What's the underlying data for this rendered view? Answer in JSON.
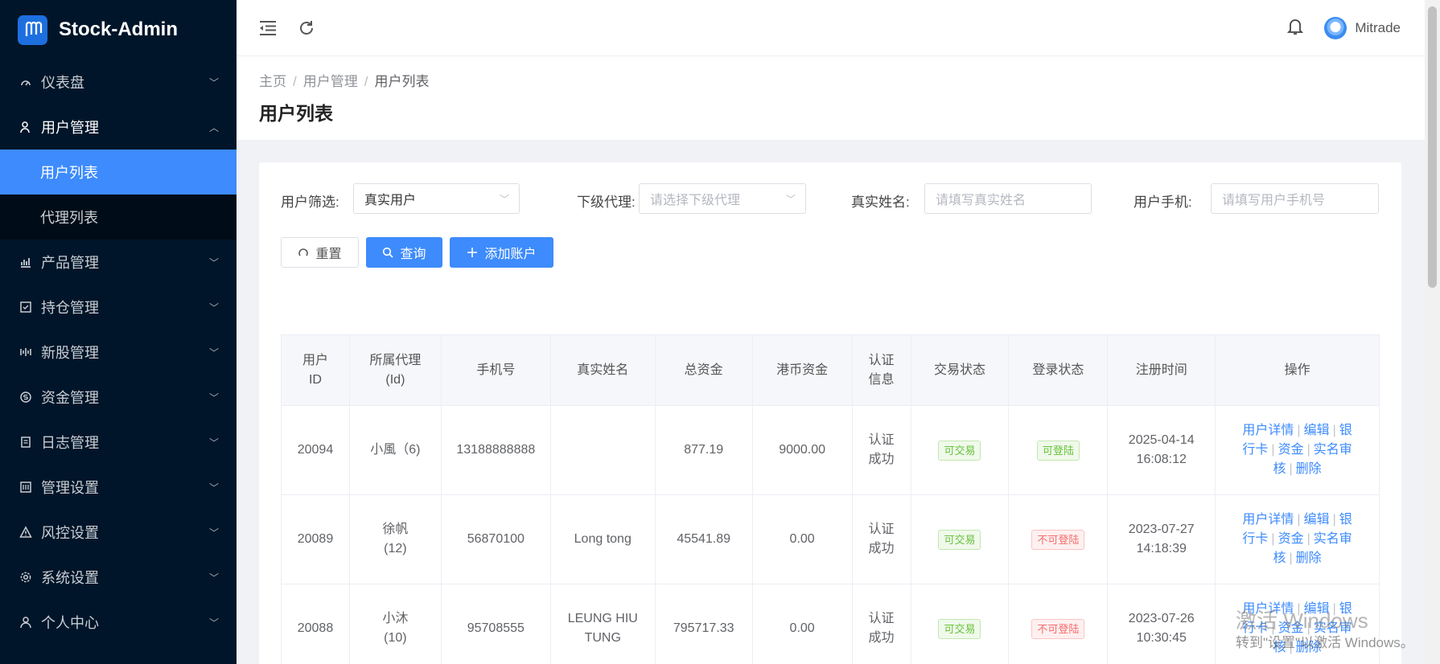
{
  "app": {
    "title": "Stock-Admin"
  },
  "sidebar": {
    "items": [
      {
        "label": "仪表盘",
        "icon": "dashboard-icon"
      },
      {
        "label": "用户管理",
        "icon": "user-manage-icon",
        "open": true,
        "children": [
          {
            "label": "用户列表",
            "active": true
          },
          {
            "label": "代理列表"
          }
        ]
      },
      {
        "label": "产品管理",
        "icon": "chart-icon"
      },
      {
        "label": "持仓管理",
        "icon": "position-icon"
      },
      {
        "label": "新股管理",
        "icon": "ipo-icon"
      },
      {
        "label": "资金管理",
        "icon": "money-icon"
      },
      {
        "label": "日志管理",
        "icon": "log-icon"
      },
      {
        "label": "管理设置",
        "icon": "admin-settings-icon"
      },
      {
        "label": "风控设置",
        "icon": "warning-icon"
      },
      {
        "label": "系统设置",
        "icon": "gear-icon"
      },
      {
        "label": "个人中心",
        "icon": "person-icon"
      }
    ]
  },
  "header": {
    "user_name": "Mitrade"
  },
  "breadcrumb": [
    "主页",
    "用户管理",
    "用户列表"
  ],
  "page_title": "用户列表",
  "filters": {
    "user_filter": {
      "label": "用户筛选:",
      "value": "真实用户"
    },
    "sub_agent": {
      "label": "下级代理:",
      "placeholder": "请选择下级代理"
    },
    "real_name": {
      "label": "真实姓名:",
      "placeholder": "请填写真实姓名"
    },
    "phone": {
      "label": "用户手机:",
      "placeholder": "请填写用户手机号"
    }
  },
  "buttons": {
    "reset": "重置",
    "search": "查询",
    "add": "添加账户"
  },
  "table": {
    "columns": [
      [
        "用户",
        "ID"
      ],
      [
        "所属代理",
        "(Id)"
      ],
      [
        "手机号"
      ],
      [
        "真实姓名"
      ],
      [
        "总资金"
      ],
      [
        "港币资金"
      ],
      [
        "认证",
        "信息"
      ],
      [
        "交易状态"
      ],
      [
        "登录状态"
      ],
      [
        "注册时间"
      ],
      [
        "操作"
      ]
    ],
    "rows": [
      {
        "id": "20094",
        "agent": [
          "小風（6)"
        ],
        "phone": "13188888888",
        "name": [
          ""
        ],
        "total": "877.19",
        "hkd": "9000.00",
        "auth": [
          "认证",
          "成功"
        ],
        "trade": "可交易",
        "trade_ok": true,
        "login": "可登陆",
        "login_ok": true,
        "reg": [
          "2025-04-14",
          "16:08:12"
        ]
      },
      {
        "id": "20089",
        "agent": [
          "徐帆",
          "(12)"
        ],
        "phone": "56870100",
        "name": [
          "Long tong"
        ],
        "total": "45541.89",
        "hkd": "0.00",
        "auth": [
          "认证",
          "成功"
        ],
        "trade": "可交易",
        "trade_ok": true,
        "login": "不可登陆",
        "login_ok": false,
        "reg": [
          "2023-07-27",
          "14:18:39"
        ]
      },
      {
        "id": "20088",
        "agent": [
          "小沐",
          "(10)"
        ],
        "phone": "95708555",
        "name": [
          "LEUNG HIU",
          "TUNG"
        ],
        "total": "795717.33",
        "hkd": "0.00",
        "auth": [
          "认证",
          "成功"
        ],
        "trade": "可交易",
        "trade_ok": true,
        "login": "不可登陆",
        "login_ok": false,
        "reg": [
          "2023-07-26",
          "10:30:45"
        ]
      }
    ],
    "ops": {
      "detail": "用户详情",
      "edit": "编辑",
      "bank_a": "银",
      "bank_b": "行卡",
      "funds": "资金",
      "audit_a": "实名审",
      "audit_b": "核",
      "delete": "删除"
    }
  },
  "watermark": {
    "line1": "激活 Windows",
    "line2": "转到\"设置\"以激活 Windows。"
  },
  "colors": {
    "sidebar_bg": "#001529",
    "accent": "#3d8bfd",
    "success": "#67c23a",
    "danger": "#f56c6c"
  }
}
